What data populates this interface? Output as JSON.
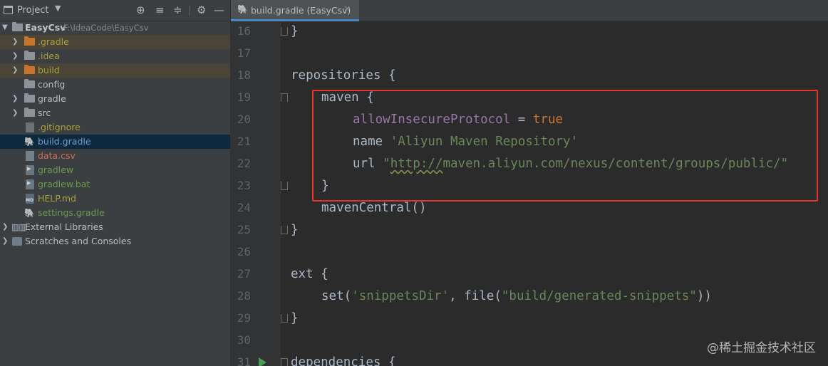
{
  "project_panel": {
    "title": "Project",
    "chevron": "▼",
    "tools": [
      "locate-icon",
      "expand-all-icon",
      "collapse-all-icon",
      "gear-icon",
      "hide-icon"
    ],
    "tool_glyphs": [
      "⊕",
      "≡",
      "≑",
      "⚙",
      "—"
    ],
    "tree": {
      "root_name": "EasyCsv",
      "root_path": "F:\\IdeaCode\\EasyCsv",
      "items": [
        {
          "label": ".gradle"
        },
        {
          "label": ".idea"
        },
        {
          "label": "build"
        },
        {
          "label": "config"
        },
        {
          "label": "gradle"
        },
        {
          "label": "src"
        },
        {
          "label": ".gitignore"
        },
        {
          "label": "build.gradle"
        },
        {
          "label": "data.csv"
        },
        {
          "label": "gradlew"
        },
        {
          "label": "gradlew.bat"
        },
        {
          "label": "HELP.md"
        },
        {
          "label": "settings.gradle"
        }
      ],
      "external_libraries": "External Libraries",
      "scratches": "Scratches and Consoles"
    }
  },
  "editor": {
    "tab": {
      "label": "build.gradle (EasyCsv)",
      "close": "×"
    },
    "line_numbers": [
      "16",
      "17",
      "18",
      "19",
      "20",
      "21",
      "22",
      "23",
      "24",
      "25",
      "26",
      "27",
      "28",
      "29",
      "30",
      "31"
    ],
    "code": {
      "l16": "}",
      "l18_kw": "repositories",
      "l18_brace": " {",
      "l19_kw": "maven",
      "l19_brace": " {",
      "l20_prop": "allowInsecureProtocol",
      "l20_eq": " = ",
      "l20_val": "true",
      "l21_kw": "name",
      "l21_str": "'Aliyun Maven Repository'",
      "l22_kw": "url",
      "l22_q1": "\"",
      "l22_url": "http://",
      "l22_rest": "maven.aliyun.com/nexus/content/groups/public/\"",
      "l23": "}",
      "l24": "mavenCentral()",
      "l25": "}",
      "l27_kw": "ext",
      "l27_brace": " {",
      "l28_fn": "set(",
      "l28_str1": "'snippetsDir'",
      "l28_mid": ", file(",
      "l28_str2": "\"build/generated-snippets\"",
      "l28_end": "))",
      "l29": "}",
      "l31_kw": "dependencies",
      "l31_brace": " {"
    }
  },
  "watermark": "@稀土掘金技术社区",
  "colors": {
    "highlight_box": "#e8352a",
    "keyword": "#cc7832",
    "string": "#6a8759",
    "property": "#9876aa"
  }
}
